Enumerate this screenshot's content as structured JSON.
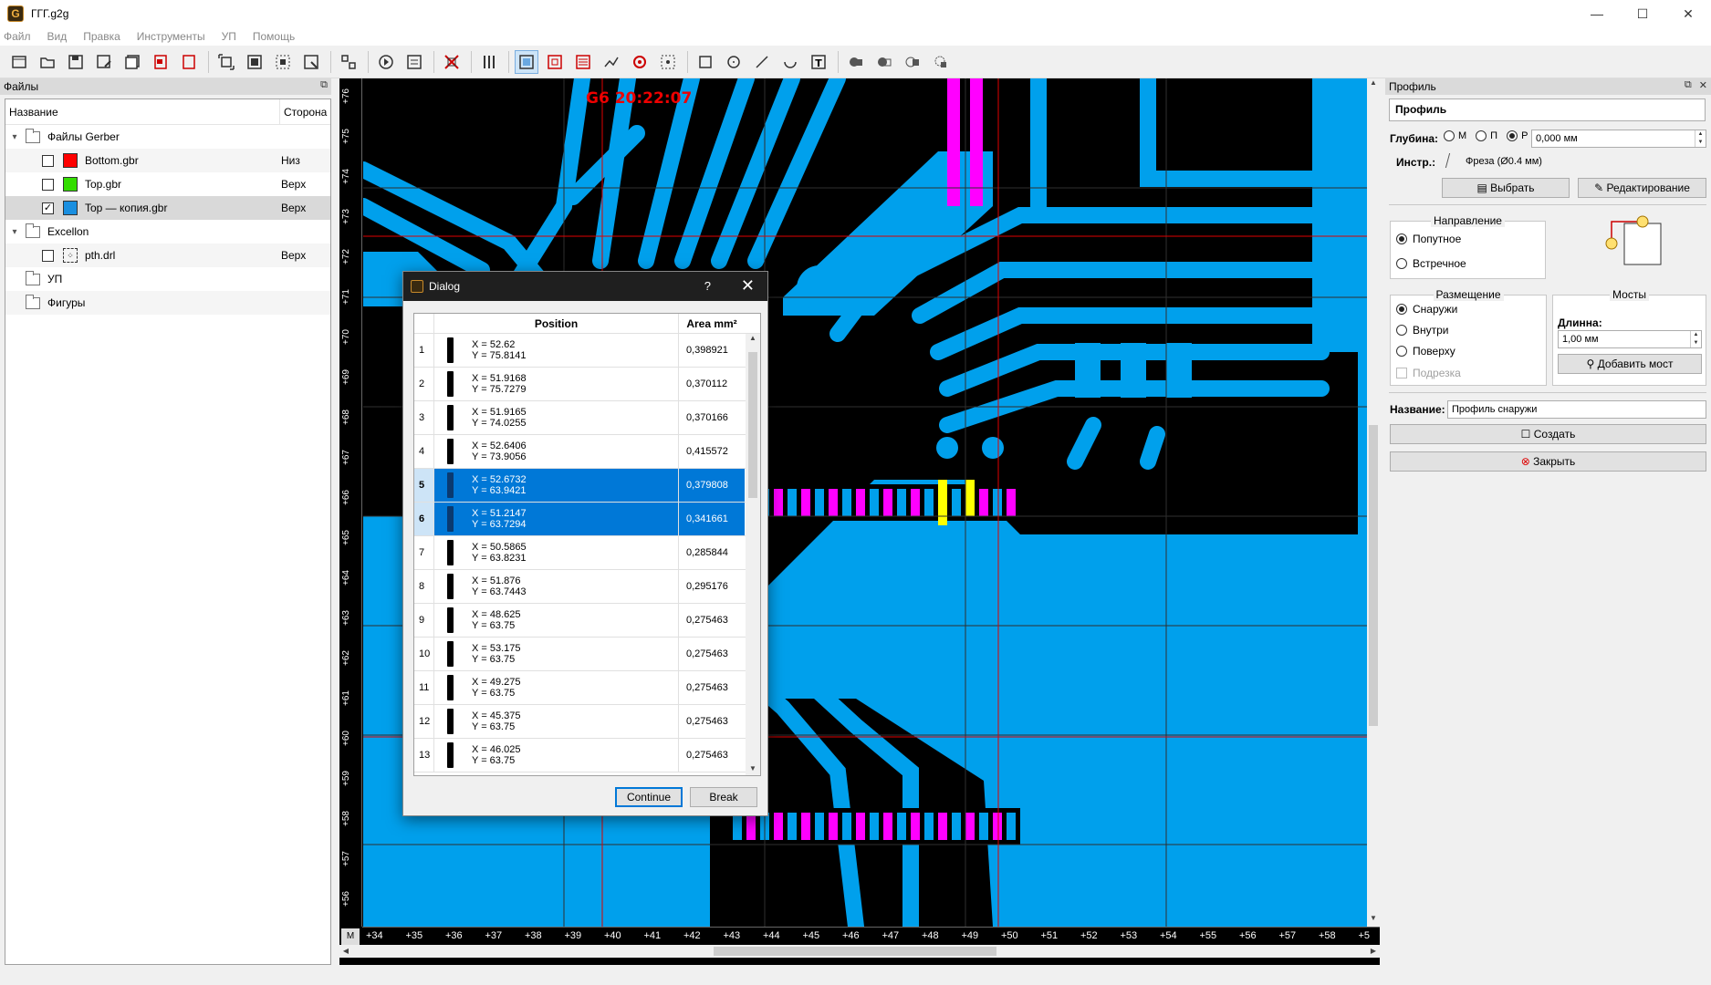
{
  "window": {
    "title": "ГГГ.g2g"
  },
  "menu": [
    "Файл",
    "Вид",
    "Правка",
    "Инструменты",
    "УП",
    "Помощь"
  ],
  "files_panel": {
    "title": "Файлы",
    "columns": {
      "name": "Название",
      "side": "Сторона"
    },
    "gerber_group": "Файлы Gerber",
    "items": [
      {
        "name": "Bottom.gbr",
        "side": "Низ",
        "color": "#ff0000",
        "checked": false
      },
      {
        "name": "Top.gbr",
        "side": "Верх",
        "color": "#33dd00",
        "checked": false
      },
      {
        "name": "Top — копия.gbr",
        "side": "Верх",
        "color": "#1a8fe0",
        "checked": true
      }
    ],
    "excellon_group": "Excellon",
    "drill_item": {
      "name": "pth.drl",
      "side": "Верх"
    },
    "up_group": "УП",
    "shapes_group": "Фигуры"
  },
  "canvas": {
    "timestamp": "G6 20:22:07",
    "corner": "M",
    "v_ticks": [
      "+76",
      "+75",
      "+74",
      "+73",
      "+72",
      "+71",
      "+70",
      "+69",
      "+68",
      "+67",
      "+66",
      "+65",
      "+64",
      "+63",
      "+62",
      "+61",
      "+60",
      "+59",
      "+58",
      "+57",
      "+56"
    ],
    "h_ticks": [
      "+34",
      "+35",
      "+36",
      "+37",
      "+38",
      "+39",
      "+40",
      "+41",
      "+42",
      "+43",
      "+44",
      "+45",
      "+46",
      "+47",
      "+48",
      "+49",
      "+50",
      "+51",
      "+52",
      "+53",
      "+54",
      "+55",
      "+56",
      "+57",
      "+58",
      "+5"
    ]
  },
  "dialog": {
    "title": "Dialog",
    "help": "?",
    "col_position": "Position",
    "col_area": "Area mm²",
    "rows": [
      {
        "n": "1",
        "x": "X = 52.62",
        "y": "Y = 75.8141",
        "area": "0,398921",
        "selected": false
      },
      {
        "n": "2",
        "x": "X = 51.9168",
        "y": "Y = 75.7279",
        "area": "0,370112",
        "selected": false
      },
      {
        "n": "3",
        "x": "X = 51.9165",
        "y": "Y = 74.0255",
        "area": "0,370166",
        "selected": false
      },
      {
        "n": "4",
        "x": "X = 52.6406",
        "y": "Y = 73.9056",
        "area": "0,415572",
        "selected": false
      },
      {
        "n": "5",
        "x": "X = 52.6732",
        "y": "Y = 63.9421",
        "area": "0,379808",
        "selected": true
      },
      {
        "n": "6",
        "x": "X = 51.2147",
        "y": "Y = 63.7294",
        "area": "0,341661",
        "selected": true
      },
      {
        "n": "7",
        "x": "X = 50.5865",
        "y": "Y = 63.8231",
        "area": "0,285844",
        "selected": false
      },
      {
        "n": "8",
        "x": "X = 51.876",
        "y": "Y = 63.7443",
        "area": "0,295176",
        "selected": false
      },
      {
        "n": "9",
        "x": "X = 48.625",
        "y": "Y = 63.75",
        "area": "0,275463",
        "selected": false
      },
      {
        "n": "10",
        "x": "X = 53.175",
        "y": "Y = 63.75",
        "area": "0,275463",
        "selected": false
      },
      {
        "n": "11",
        "x": "X = 49.275",
        "y": "Y = 63.75",
        "area": "0,275463",
        "selected": false
      },
      {
        "n": "12",
        "x": "X = 45.375",
        "y": "Y = 63.75",
        "area": "0,275463",
        "selected": false
      },
      {
        "n": "13",
        "x": "X = 46.025",
        "y": "Y = 63.75",
        "area": "0,275463",
        "selected": false
      }
    ],
    "continue_label": "Continue",
    "break_label": "Break"
  },
  "profile": {
    "dock_title": "Профиль",
    "name_field": "Профиль",
    "depth_label": "Глубина:",
    "depth_options": [
      "М",
      "П",
      "Р"
    ],
    "depth_value": "0,000 мм",
    "tool_label": "Инстр.:",
    "tool_value": "Фреза (Ø0.4 мм)",
    "select_button": "Выбрать",
    "edit_button": "Редактирование",
    "direction": {
      "title": "Направление",
      "options": [
        "Попутное",
        "Встречное"
      ]
    },
    "placement": {
      "title": "Размещение",
      "options": [
        "Снаружи",
        "Внутри",
        "Поверху",
        "Подрезка"
      ]
    },
    "bridges": {
      "title": "Мосты",
      "length_label": "Длинна:",
      "length_value": "1,00 мм",
      "add_button": "Добавить мост"
    },
    "name_label": "Название:",
    "name_value": "Профиль снаружи",
    "create_button": "Создать",
    "close_button": "Закрыть"
  },
  "colors": {
    "copper": "#00a0ec",
    "board": "#000000",
    "highlight": "#ff00ff",
    "selected_pad": "#ffff00",
    "selection": "#0078d7"
  }
}
